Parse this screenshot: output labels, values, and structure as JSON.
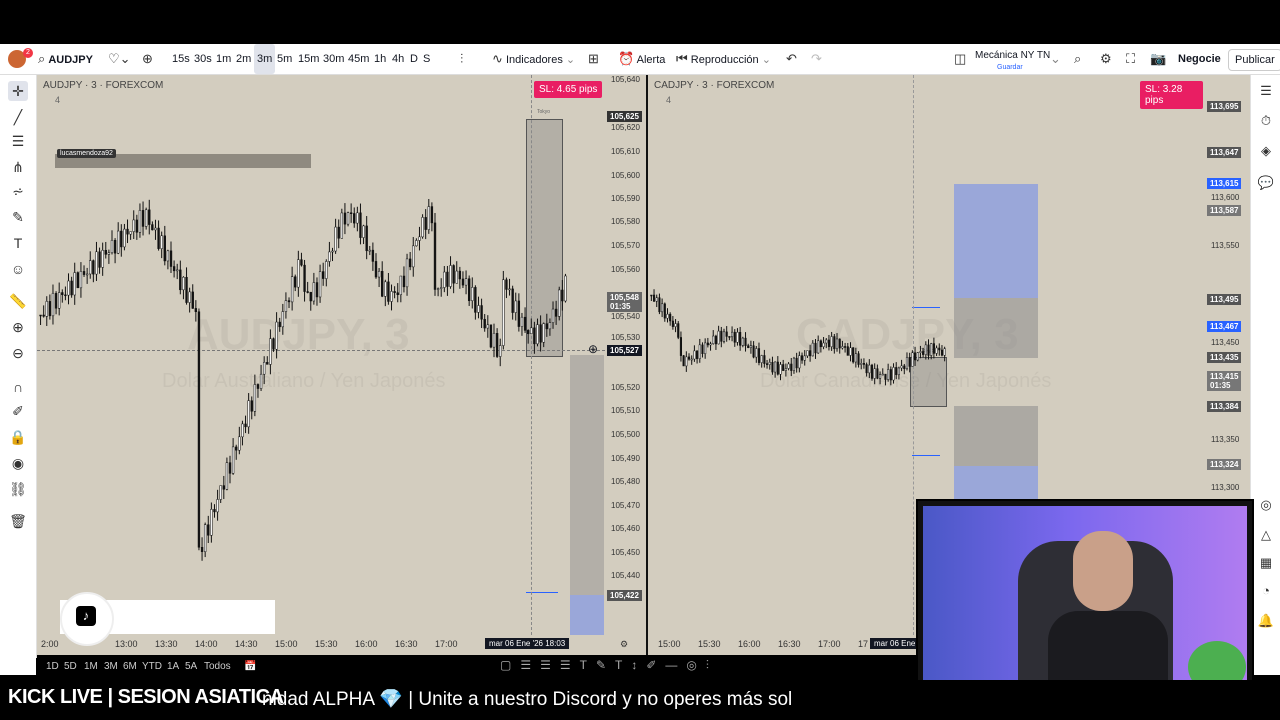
{
  "toolbar": {
    "symbol": "AUDJPY",
    "timeframes": [
      "15s",
      "30s",
      "1m",
      "2m",
      "3m",
      "5m",
      "15m",
      "30m",
      "45m",
      "1h",
      "4h",
      "D",
      "S"
    ],
    "active_timeframe": "3m",
    "indicators": "Indicadores",
    "alert": "Alerta",
    "replay": "Reproducción",
    "layout_name": "Mecánica NY TN",
    "layout_status": "Guardar",
    "trade": "Negocie",
    "publish": "Publicar",
    "notif_count": "2"
  },
  "left_chart": {
    "title": "AUDJPY · 3 · FOREXCOM",
    "sub": "4",
    "watermark": "AUDJPY, 3",
    "watermark_sub": "Dolar Australiano / Yen Japonés",
    "sl_badge": "SL: 4.65 pips",
    "annotation_user": "lucasmendoza92",
    "position_label": "Tokyo",
    "price_labels": [
      "105,640",
      "105,620",
      "105,610",
      "105,600",
      "105,590",
      "105,580",
      "105,570",
      "105,560",
      "105,540",
      "105,530",
      "105,520",
      "105,510",
      "105,500",
      "105,490",
      "105,480",
      "105,470",
      "105,460",
      "105,450",
      "105,440",
      "105,430"
    ],
    "tag_top": "105,625",
    "tag_current": "105,548",
    "tag_current_time": "01:35",
    "tag_cross": "105,527",
    "tag_bottom": "105,422",
    "time_labels": [
      "2:00",
      "13:00",
      "13:30",
      "14:00",
      "14:30",
      "15:00",
      "15:30",
      "16:00",
      "16:30",
      "17:00"
    ],
    "time_cursor": "mar 06 Ene '26  18:03"
  },
  "right_chart": {
    "title": "CADJPY · 3 · FOREXCOM",
    "sub": "4",
    "watermark": "CADJPY, 3",
    "watermark_sub": "Dólar Canadiense / Yen Japonés",
    "sl_badge": "SL: 3.28 pips",
    "position_label": "Tokyo",
    "price_labels": [
      "113,600",
      "113,550",
      "113,450",
      "113,350",
      "113,300"
    ],
    "tag_695": "113,695",
    "tag_647": "113,647",
    "tag_615": "113,615",
    "tag_587": "113,587",
    "tag_495": "113,495",
    "tag_467": "113,467",
    "tag_435": "113,435",
    "tag_415": "113,415",
    "tag_415_time": "01:35",
    "tag_384": "113,384",
    "tag_324": "113,324",
    "time_labels": [
      "15:00",
      "15:30",
      "16:00",
      "16:30",
      "17:00",
      "17"
    ],
    "time_cursor": "mar 06 Ene"
  },
  "range_bar": [
    "1D",
    "5D",
    "1M",
    "3M",
    "6M",
    "YTD",
    "1A",
    "5A",
    "Todos"
  ],
  "ticker": {
    "left": "KICK LIVE | SESION ASIATICA",
    "scroll": "nidad ALPHA  💎  | Unite a nuestro  Discord y no operes más sol"
  },
  "colors": {
    "chart_bg": "#d3cdbf",
    "sl_pink": "#e91e63",
    "tp_blue": "#9aa7d9",
    "tag_blue": "#2962ff"
  }
}
